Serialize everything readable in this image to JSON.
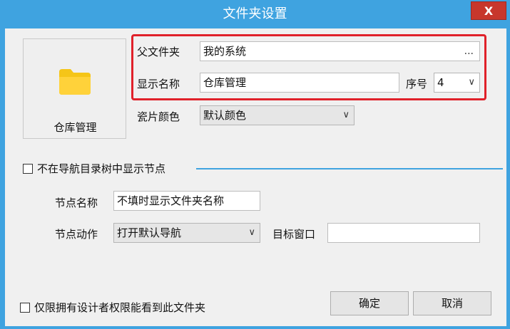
{
  "window": {
    "title": "文件夹设置",
    "close_label": "X"
  },
  "tile": {
    "label": "仓库管理",
    "icon": "folder-icon",
    "icon_color": "#f5c518"
  },
  "parent_folder": {
    "label": "父文件夹",
    "value": "我的系统",
    "browse_label": "..."
  },
  "display_name": {
    "label": "显示名称",
    "value": "仓库管理"
  },
  "order": {
    "label": "序号",
    "value": "4"
  },
  "tile_color": {
    "label": "瓷片颜色",
    "value": "默认颜色"
  },
  "hide_in_tree": {
    "label": "不在导航目录树中显示节点",
    "checked": false
  },
  "node_name": {
    "label": "节点名称",
    "value": "不填时显示文件夹名称"
  },
  "node_action": {
    "label": "节点动作",
    "value": "打开默认导航"
  },
  "target_window": {
    "label": "目标窗口",
    "value": ""
  },
  "designer_only": {
    "label": "仅限拥有设计者权限能看到此文件夹",
    "checked": false
  },
  "buttons": {
    "ok": "确定",
    "cancel": "取消"
  },
  "colors": {
    "title_bar": "#3fa3e0",
    "highlight_box": "#e0212a",
    "close_button": "#c7372c"
  }
}
